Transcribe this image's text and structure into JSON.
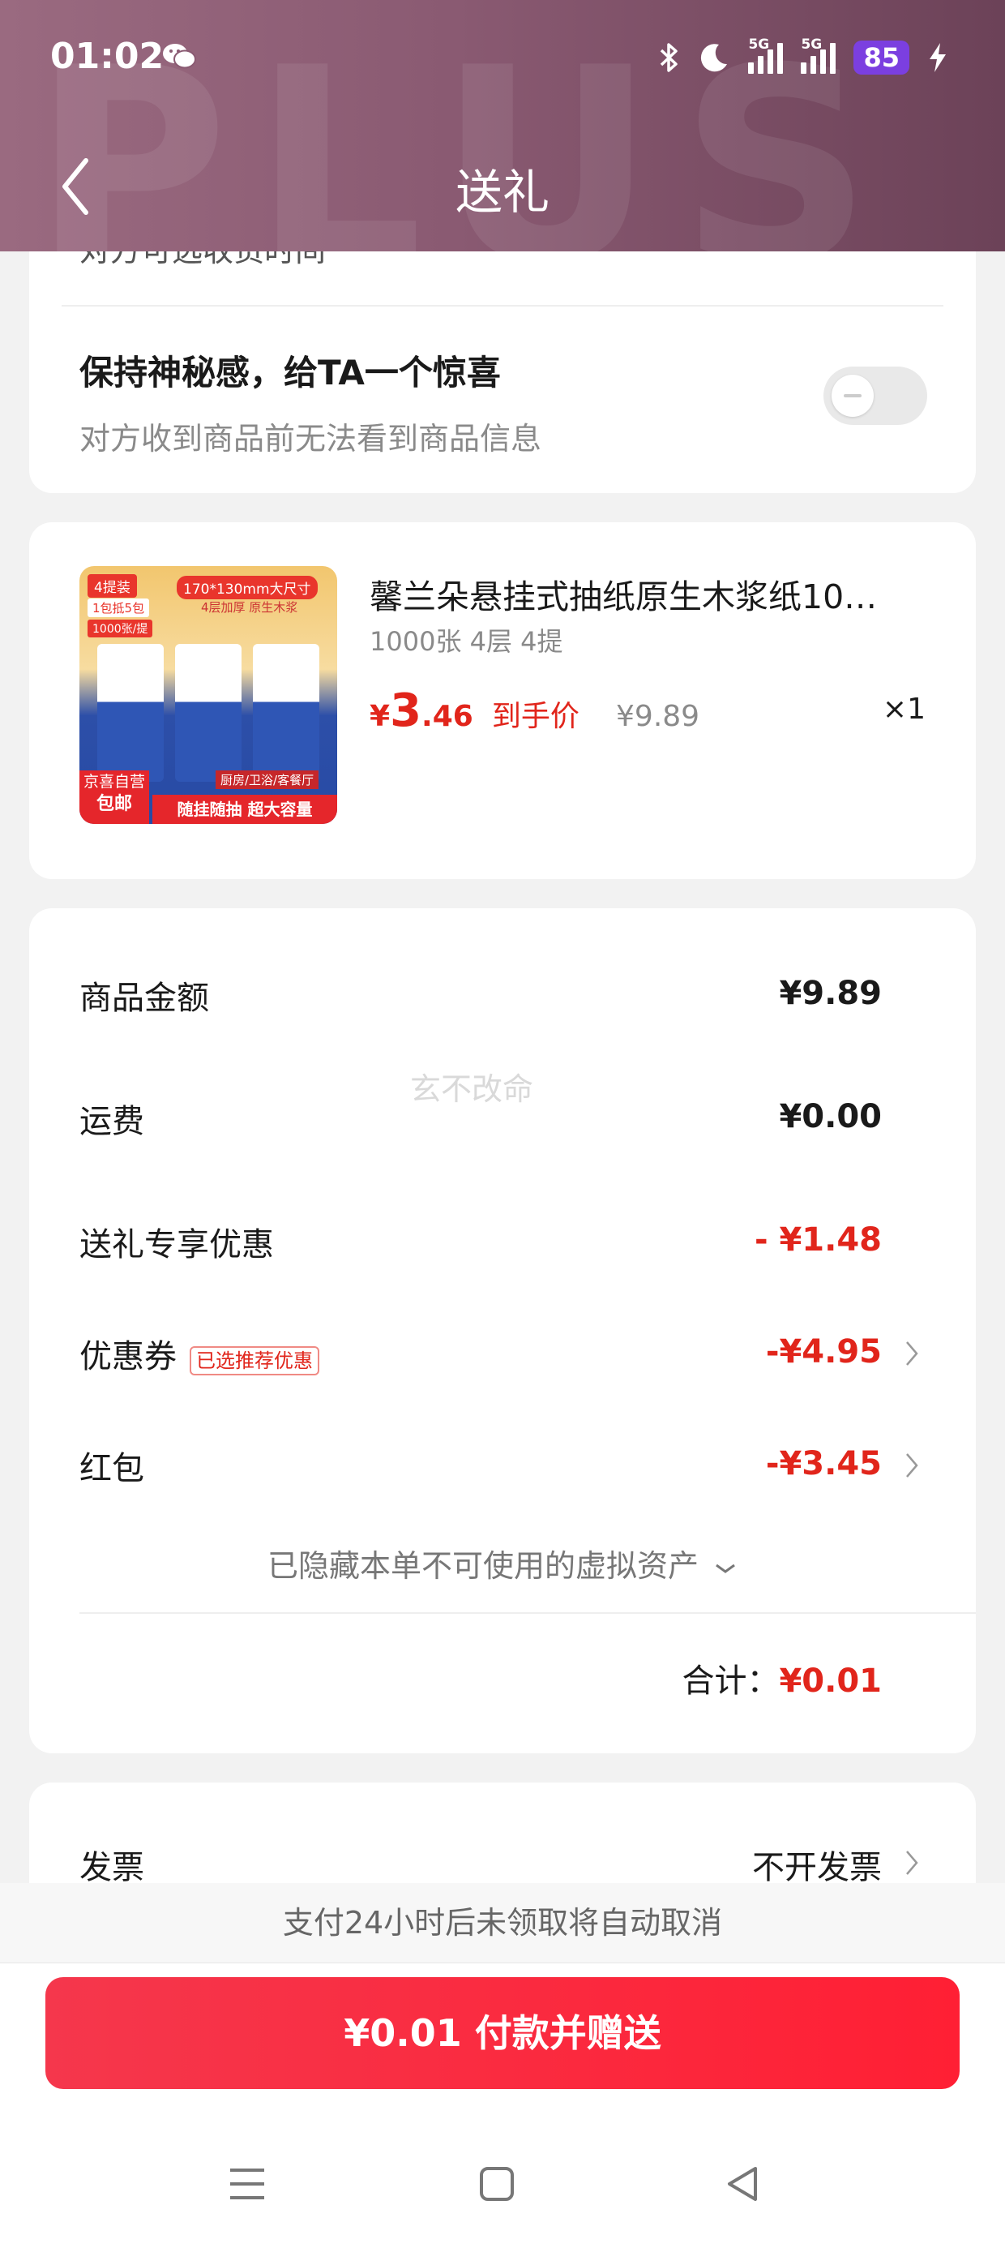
{
  "status_bar": {
    "time": "01:02",
    "sig1_label": "5G",
    "sig2_label": "5G",
    "battery": "85"
  },
  "header": {
    "title": "送礼",
    "watermark": "PLUS"
  },
  "surprise": {
    "partial_text": "对方可选收货时间",
    "title": "保持神秘感，给TA一个惊喜",
    "subtitle": "对方收到商品前无法看到商品信息",
    "toggle_on": false
  },
  "product": {
    "name": "馨兰朵悬挂式抽纸原生木浆纸10…",
    "spec": "1000张 4层 4提",
    "price_symbol": "¥",
    "price_int": "3",
    "price_dec": ".46",
    "price_tag": "到手价",
    "original_price": "¥9.89",
    "qty": "×1",
    "image_text": {
      "tag1": "4提装",
      "tag2": "1包抵5包",
      "tag3": "1000张/提",
      "size": "170*130mm大尺寸",
      "layer": "4层加厚 原生木浆",
      "badge1": "京喜自营",
      "badge2": "包邮",
      "usage": "厨房/卫浴/客餐厅",
      "slogan": "随挂随抽 超大容量"
    }
  },
  "summary": {
    "goods_label": "商品金额",
    "goods_value": "¥9.89",
    "shipping_label": "运费",
    "shipping_value": "¥0.00",
    "gift_label": "送礼专享优惠",
    "gift_value": "- ¥1.48",
    "coupon_label": "优惠券",
    "coupon_tag": "已选推荐优惠",
    "coupon_value": "-¥4.95",
    "redpack_label": "红包",
    "redpack_value": "-¥3.45",
    "hidden_assets": "已隐藏本单不可使用的虚拟资产",
    "total_label": "合计：",
    "total_value": "¥0.01",
    "watermark": "玄不改命"
  },
  "invoice": {
    "label": "发票",
    "value": "不开发票"
  },
  "footer": {
    "notice": "支付24小时后未领取将自动取消",
    "pay_button": "¥0.01 付款并赠送"
  },
  "colors": {
    "accent_red": "#e1251b",
    "button_red": "#f5374c",
    "header_mauve": "#8a5a72",
    "battery_purple": "#7b3fe0"
  }
}
